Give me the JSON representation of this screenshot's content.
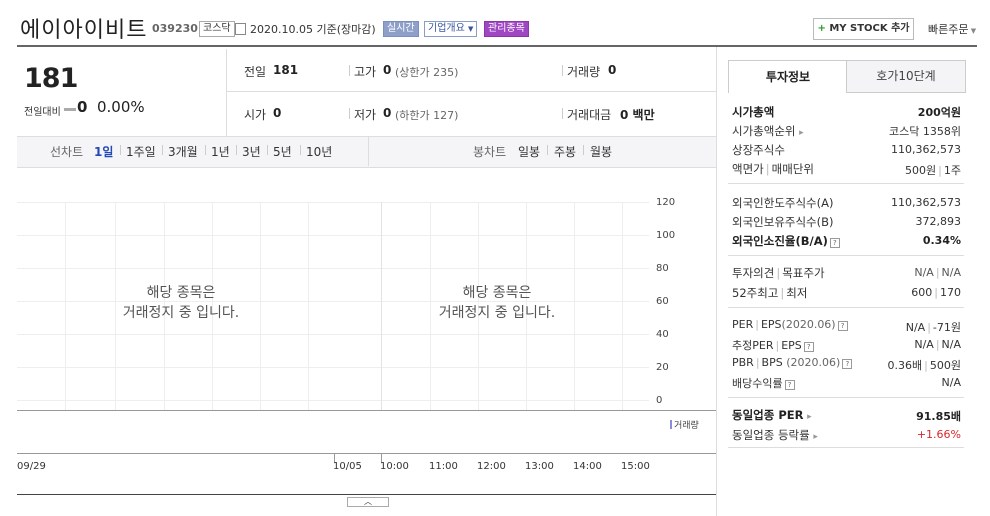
{
  "header": {
    "stock_name": "에이아이비트",
    "stock_code": "039230",
    "market_tag": "코스닥",
    "date_text": "2020.10.05 기준(장마감)",
    "realtime_tag": "실시간",
    "company_info_tag": "기업개요",
    "management_tag": "관리종목",
    "my_stock_button": "MY STOCK 추가",
    "quick_order": "빠른주문"
  },
  "summary": {
    "price": "181",
    "change_label": "전일대비",
    "change_value": "0",
    "change_percent": "0.00%",
    "prev_close_label": "전일",
    "prev_close": "181",
    "high_label": "고가",
    "high": "0",
    "upper_limit": "(상한가 235)",
    "volume_label": "거래량",
    "volume": "0",
    "open_label": "시가",
    "open": "0",
    "low_label": "저가",
    "low": "0",
    "lower_limit": "(하한가 127)",
    "amount_label": "거래대금",
    "amount": "0 백만"
  },
  "chart_tabs": {
    "line_label": "선차트",
    "periods": [
      "1일",
      "1주일",
      "3개월",
      "1년",
      "3년",
      "5년",
      "10년"
    ],
    "active_period": "1일",
    "candle_label": "봉차트",
    "candles": [
      "일봉",
      "주봉",
      "월봉"
    ]
  },
  "chart": {
    "halt_message_line1": "해당 종목은",
    "halt_message_line2": "거래정지 중 입니다.",
    "y_ticks": [
      "120",
      "100",
      "80",
      "60",
      "40",
      "20",
      "0"
    ],
    "x_ticks": [
      "09/29",
      "10/05",
      "10:00",
      "11:00",
      "12:00",
      "13:00",
      "14:00",
      "15:00"
    ],
    "volume_legend": "거래량"
  },
  "invest_panel": {
    "tab_active": "투자정보",
    "tab_other": "호가10단계",
    "market_cap_label": "시가총액",
    "market_cap": "200억원",
    "market_cap_rank_label": "시가총액순위",
    "market_cap_rank": "코스닥 1358위",
    "shares_label": "상장주식수",
    "shares": "110,362,573",
    "par_label": "액면가",
    "trade_unit_label": "매매단위",
    "par_value": "500원",
    "trade_unit": "1주",
    "foreign_limit_label": "외국인한도주식수(A)",
    "foreign_limit": "110,362,573",
    "foreign_hold_label": "외국인보유주식수(B)",
    "foreign_hold": "372,893",
    "foreign_ratio_label": "외국인소진율(B/A)",
    "foreign_ratio": "0.34%",
    "opinion_label": "투자의견",
    "target_label": "목표주가",
    "opinion": "N/A",
    "target": "N/A",
    "week52_high_label": "52주최고",
    "week52_low_label": "최저",
    "week52_high": "600",
    "week52_low": "170",
    "per_label": "PER",
    "eps_label": "EPS",
    "eps_year": "(2020.06)",
    "per": "N/A",
    "eps": "-71원",
    "est_per_label": "추정PER",
    "est_eps_label": "EPS",
    "est_per": "N/A",
    "est_eps": "N/A",
    "pbr_label": "PBR",
    "bps_label": "BPS",
    "bps_year": "(2020.06)",
    "pbr": "0.36배",
    "bps": "500원",
    "dividend_label": "배당수익률",
    "dividend": "N/A",
    "sector_per_label": "동일업종 PER",
    "sector_per": "91.85배",
    "sector_change_label": "동일업종 등락률",
    "sector_change": "+1.66%",
    "colors": {
      "positive": "#d6282c",
      "active_tab": "#2349b5"
    }
  }
}
